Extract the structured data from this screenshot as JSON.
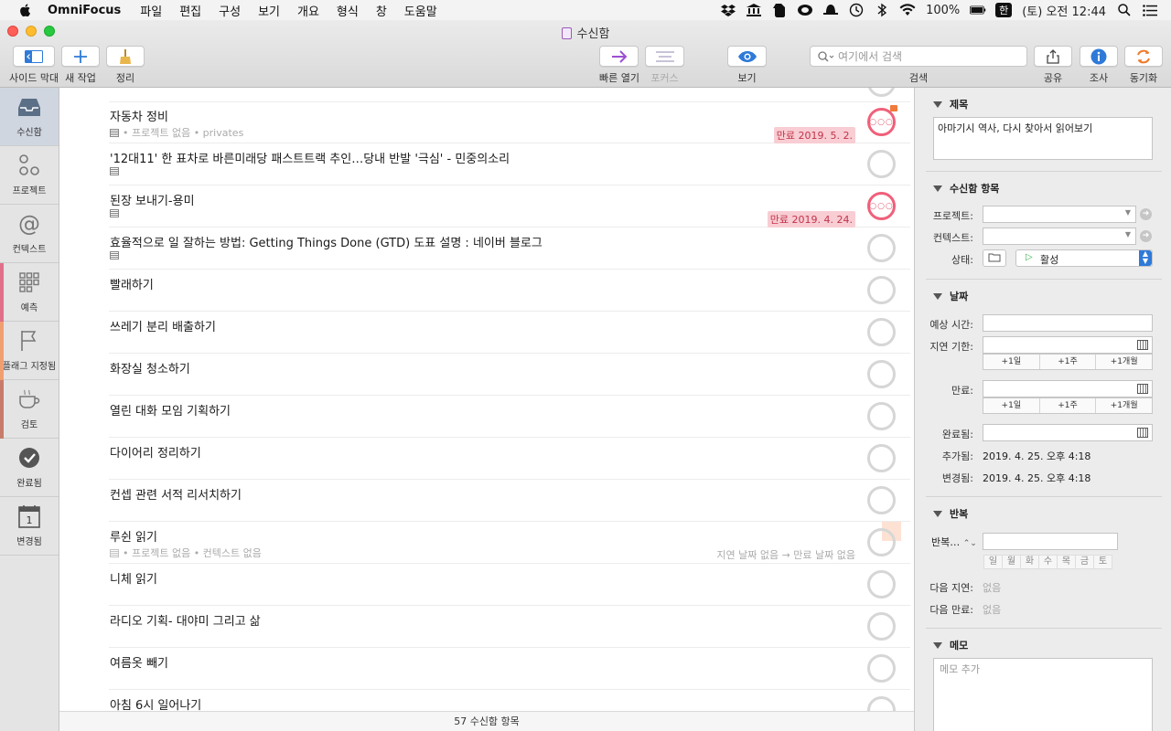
{
  "menubar": {
    "app": "OmniFocus",
    "items": [
      "파일",
      "편집",
      "구성",
      "보기",
      "개요",
      "형식",
      "창",
      "도움말"
    ],
    "battery": "100%",
    "input_source": "한",
    "clock": "(토) 오전 12:44"
  },
  "window": {
    "title": "수신함"
  },
  "toolbar": {
    "sidebar": "사이드 막대",
    "new_task": "새 작업",
    "cleanup": "정리",
    "quick_open": "빠른 열기",
    "focus": "포커스",
    "view": "보기",
    "search_placeholder": "여기에서 검색",
    "search_label": "검색",
    "share": "공유",
    "inspect": "조사",
    "sync": "동기화"
  },
  "sidebar": {
    "items": [
      {
        "label": "수신함",
        "icon": "inbox-icon"
      },
      {
        "label": "프로젝트",
        "icon": "projects-icon"
      },
      {
        "label": "컨텍스트",
        "icon": "at-sign-icon"
      },
      {
        "label": "예측",
        "icon": "forecast-grid-icon",
        "color": "#e0708a"
      },
      {
        "label": "플래그 지정됨",
        "icon": "flag-icon",
        "color": "#f0a070"
      },
      {
        "label": "검토",
        "icon": "coffee-cup-icon",
        "color": "#c77b6a"
      },
      {
        "label": "완료됨",
        "icon": "checkmark-icon"
      },
      {
        "label": "변경됨",
        "icon": "calendar-icon"
      }
    ]
  },
  "tasks": [
    {
      "title": "자동차 정비",
      "sub": "• 프로젝트 없음 • privates",
      "due": "만료 2019. 5. 2.",
      "status": "overdue"
    },
    {
      "title": "'12대11' 한 표차로 바른미래당 패스트트랙 추인…당내 반발 '극심' - 민중의소리",
      "sub": ""
    },
    {
      "title": "된장 보내기-용미",
      "sub": "",
      "due": "만료 2019. 4. 24.",
      "status": "overdue"
    },
    {
      "title": "효율적으로 일 잘하는 방법: Getting Things Done (GTD) 도표 설명 : 네이버 블로그",
      "sub": ""
    },
    {
      "title": "빨래하기"
    },
    {
      "title": "쓰레기 분리 배출하기"
    },
    {
      "title": "화장실 청소하기"
    },
    {
      "title": "열린 대화 모임 기획하기"
    },
    {
      "title": "다이어리 정리하기"
    },
    {
      "title": "컨셉 관련 서적 리서치하기"
    },
    {
      "title": "루쉰 읽기",
      "sub": "• 프로젝트 없음 • 컨텍스트 없음",
      "meta_right": "지연 날짜 없음 → 만료 날짜 없음"
    },
    {
      "title": "니체 읽기"
    },
    {
      "title": "라디오 기획- 대야미 그리고 삶"
    },
    {
      "title": "여름옷 빼기"
    },
    {
      "title": "아침 6시 일어나기"
    }
  ],
  "status_bar": "57 수신함 항목",
  "inspector": {
    "title_section": "제목",
    "title_value": "아마기시 역사, 다시 찾아서 읽어보기",
    "inbox_section": "수신함 항목",
    "project_label": "프로젝트:",
    "context_label": "컨텍스트:",
    "status_label": "상태:",
    "status_value": "활성",
    "date_section": "날짜",
    "estimate_label": "예상 시간:",
    "defer_label": "지연 기한:",
    "due_label": "만료:",
    "completed_label": "완료됨:",
    "added_label": "추가됨:",
    "added_value": "2019. 4. 25. 오후 4:18",
    "modified_label": "변경됨:",
    "modified_value": "2019. 4. 25. 오후 4:18",
    "quick_buttons": [
      "+1일",
      "+1주",
      "+1개월"
    ],
    "repeat_section": "반복",
    "repeat_label": "반복…",
    "weekdays": [
      "일",
      "월",
      "화",
      "수",
      "목",
      "금",
      "토"
    ],
    "next_defer_label": "다음 지연:",
    "next_defer_value": "없음",
    "next_due_label": "다음 만료:",
    "next_due_value": "없음",
    "note_section": "메모",
    "note_placeholder": "메모 추가"
  }
}
